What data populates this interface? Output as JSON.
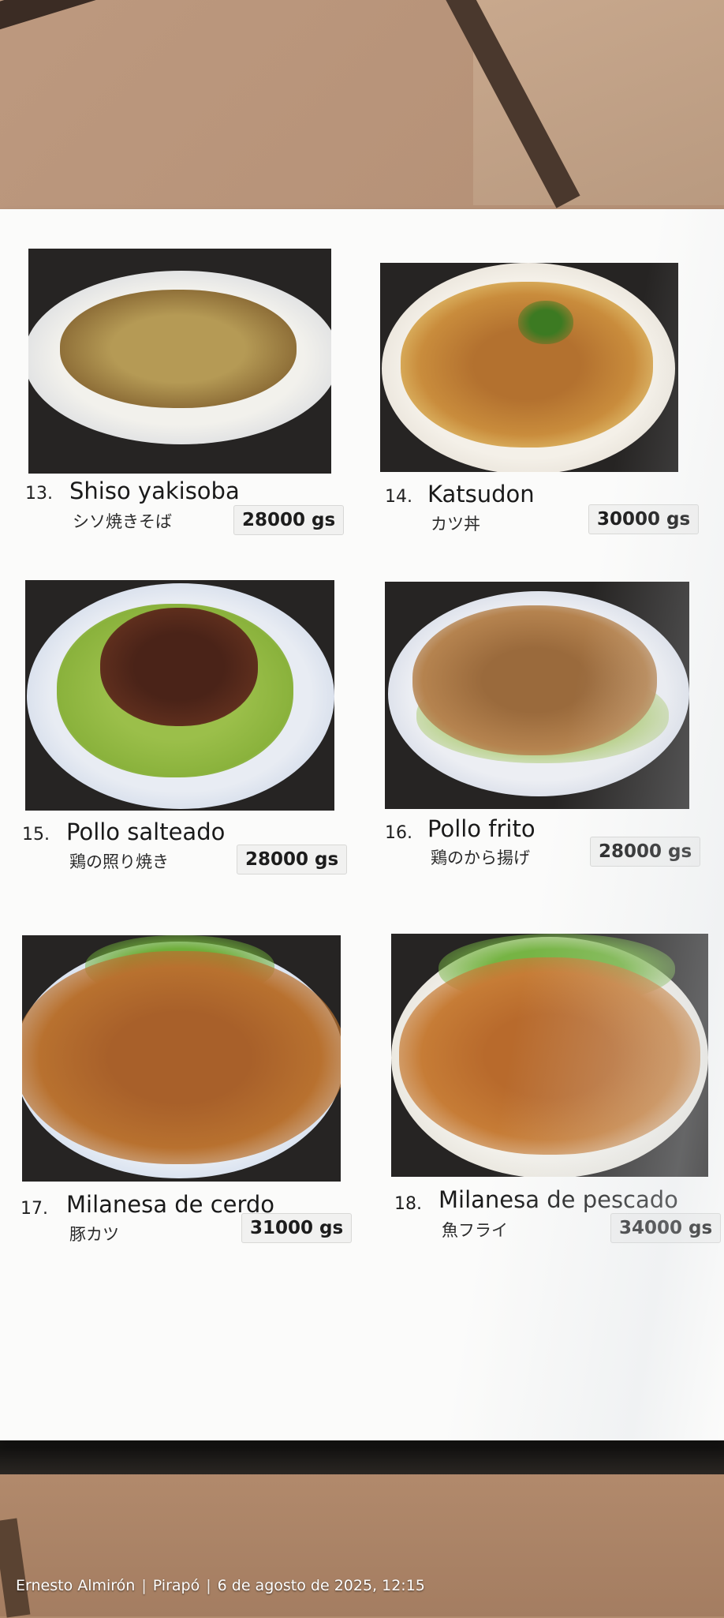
{
  "menu": {
    "items": [
      {
        "number": "13.",
        "name": "Shiso yakisoba",
        "name_jp": "シソ焼きそば",
        "price": "28000 gs"
      },
      {
        "number": "14.",
        "name": "Katsudon",
        "name_jp": "カツ丼",
        "price": "30000 gs"
      },
      {
        "number": "15.",
        "name": "Pollo salteado",
        "name_jp": "鶏の照り焼き",
        "price": "28000 gs"
      },
      {
        "number": "16.",
        "name": "Pollo frito",
        "name_jp": "鶏のから揚げ",
        "price": "28000 gs"
      },
      {
        "number": "17.",
        "name": "Milanesa de cerdo",
        "name_jp": "豚カツ",
        "price": "31000 gs"
      },
      {
        "number": "18.",
        "name": "Milanesa de pescado",
        "name_jp": "魚フライ",
        "price": "34000 gs"
      }
    ]
  },
  "watermark": {
    "author": "Ernesto Almirón",
    "place": "Pirapó",
    "datetime": "6 de agosto de 2025, 12:15",
    "separator": "|"
  },
  "colors": {
    "sheet": "#fbfbfa",
    "floor": "#b58d70",
    "text": "#1a1a1a"
  }
}
